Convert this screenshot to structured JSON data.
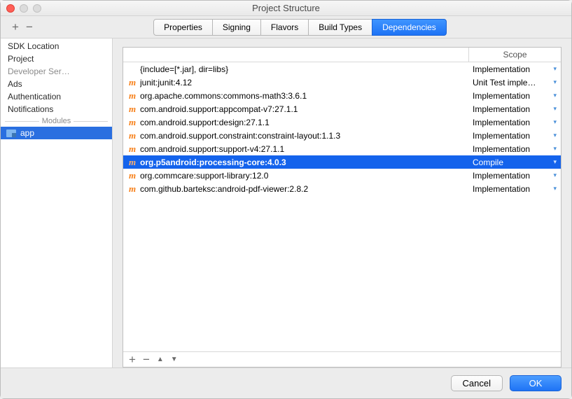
{
  "window": {
    "title": "Project Structure"
  },
  "topIcons": {
    "add": "+",
    "remove": "−"
  },
  "tabs": [
    {
      "label": "Properties",
      "active": false
    },
    {
      "label": "Signing",
      "active": false
    },
    {
      "label": "Flavors",
      "active": false
    },
    {
      "label": "Build Types",
      "active": false
    },
    {
      "label": "Dependencies",
      "active": true
    }
  ],
  "sidebar": {
    "items": [
      {
        "label": "SDK Location",
        "disabled": false
      },
      {
        "label": "Project",
        "disabled": false
      },
      {
        "label": "Developer Ser…",
        "disabled": true
      },
      {
        "label": "Ads",
        "disabled": false
      },
      {
        "label": "Authentication",
        "disabled": false
      },
      {
        "label": "Notifications",
        "disabled": false
      }
    ],
    "modulesHeader": "Modules",
    "modules": [
      {
        "label": "app",
        "selected": true
      }
    ]
  },
  "depHeader": {
    "scope": "Scope"
  },
  "deps": [
    {
      "icon": "",
      "name": "{include=[*.jar], dir=libs}",
      "scope": "Implementation",
      "selected": false
    },
    {
      "icon": "m",
      "name": "junit:junit:4.12",
      "scope": "Unit Test imple…",
      "selected": false
    },
    {
      "icon": "m",
      "name": "org.apache.commons:commons-math3:3.6.1",
      "scope": "Implementation",
      "selected": false
    },
    {
      "icon": "m",
      "name": "com.android.support:appcompat-v7:27.1.1",
      "scope": "Implementation",
      "selected": false
    },
    {
      "icon": "m",
      "name": "com.android.support:design:27.1.1",
      "scope": "Implementation",
      "selected": false
    },
    {
      "icon": "m",
      "name": "com.android.support.constraint:constraint-layout:1.1.3",
      "scope": "Implementation",
      "selected": false
    },
    {
      "icon": "m",
      "name": "com.android.support:support-v4:27.1.1",
      "scope": "Implementation",
      "selected": false
    },
    {
      "icon": "m",
      "name": "org.p5android:processing-core:4.0.3",
      "scope": "Compile",
      "selected": true
    },
    {
      "icon": "m",
      "name": "org.commcare:support-library:12.0",
      "scope": "Implementation",
      "selected": false
    },
    {
      "icon": "m",
      "name": "com.github.barteksc:android-pdf-viewer:2.8.2",
      "scope": "Implementation",
      "selected": false
    }
  ],
  "listTools": {
    "add": "+",
    "remove": "−",
    "up": "▲",
    "down": "▼"
  },
  "footer": {
    "cancel": "Cancel",
    "ok": "OK"
  }
}
